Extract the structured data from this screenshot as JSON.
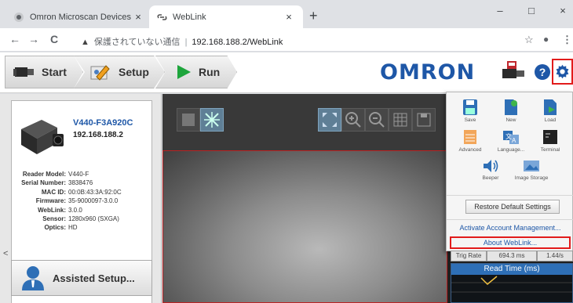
{
  "browser": {
    "tabs": [
      {
        "label": "Omron Microscan Devices",
        "close": "×"
      },
      {
        "label": "WebLink",
        "close": "×"
      }
    ],
    "new_tab": "+",
    "window_controls": {
      "minimize": "–",
      "maximize": "□",
      "close": "×"
    },
    "nav": {
      "back": "←",
      "forward": "→",
      "reload": "C"
    },
    "address": {
      "warning_icon": "▲",
      "security_text": "保護されていない通信",
      "separator": "|",
      "url": "192.168.188.2/WebLink"
    },
    "toolbar_right": {
      "star": "☆",
      "account": "●",
      "menu": "⋮"
    }
  },
  "app": {
    "steps": [
      {
        "label": "Start",
        "icon": "camera-icon"
      },
      {
        "label": "Setup",
        "icon": "settings-pen-icon"
      },
      {
        "label": "Run",
        "icon": "play-icon"
      }
    ],
    "logo": "OMRON",
    "header_icons": [
      "camera-save-icon",
      "help-icon",
      "gear-icon"
    ],
    "help_glyph": "?"
  },
  "device": {
    "name": "V440-F3A920C",
    "ip": "192.168.188.2",
    "specs": [
      {
        "key": "Reader Model:",
        "value": "V440-F"
      },
      {
        "key": "Serial Number:",
        "value": "3838476"
      },
      {
        "key": "MAC ID:",
        "value": "00:0B:43:3A:92:0C"
      },
      {
        "key": "Firmware:",
        "value": "35-9000097-3.0.0"
      },
      {
        "key": "WebLink:",
        "value": "3.0.0"
      },
      {
        "key": "Sensor:",
        "value": "1280x960 (SXGA)"
      },
      {
        "key": "Optics:",
        "value": "HD"
      }
    ]
  },
  "left_panel": {
    "collapse_glyph": "<",
    "assisted_setup": "Assisted Setup..."
  },
  "menu": {
    "items": [
      {
        "label": "Save",
        "icon": "save-icon"
      },
      {
        "label": "New",
        "icon": "new-file-icon"
      },
      {
        "label": "Load",
        "icon": "load-icon"
      },
      {
        "label": "Advanced",
        "icon": "advanced-icon"
      },
      {
        "label": "Language...",
        "icon": "language-icon"
      },
      {
        "label": "Terminal",
        "icon": "terminal-icon"
      },
      {
        "label": "Beeper",
        "icon": "speaker-icon"
      },
      {
        "label": "Image Storage",
        "icon": "image-storage-icon"
      }
    ],
    "restore_button": "Restore Default Settings",
    "activate_link": "Activate Account Management...",
    "about_link": "About WebLink..."
  },
  "stats": [
    {
      "label": "Trig Rate"
    },
    {
      "label": "694.3 ms"
    },
    {
      "label": "1.44/s"
    }
  ],
  "read_time": {
    "title": "Read Time (ms)"
  },
  "colors": {
    "accent_blue": "#1e57a7",
    "highlight_red": "#e21b1b",
    "run_green": "#1ea53c"
  }
}
